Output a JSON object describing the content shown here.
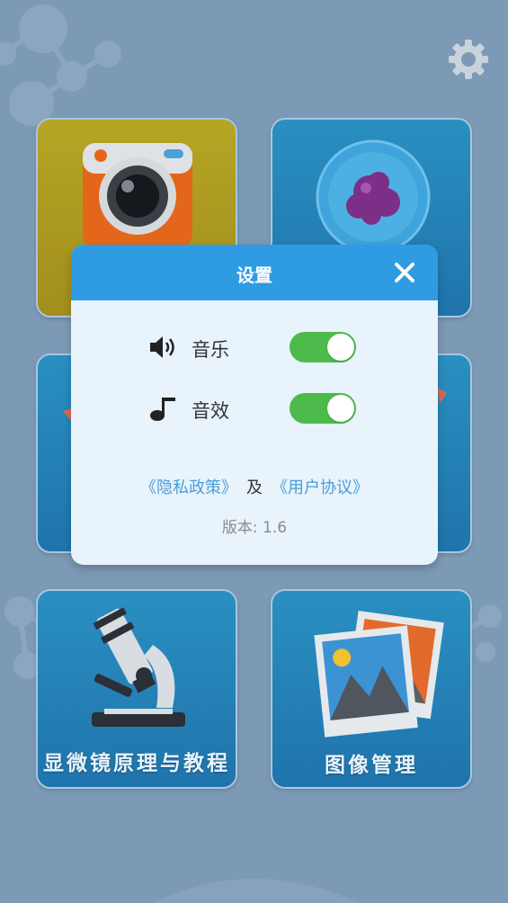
{
  "home": {
    "tiles": [
      {
        "label": ""
      },
      {
        "label": ""
      },
      {
        "label": ""
      },
      {
        "label": ""
      },
      {
        "label": "显微镜原理与教程"
      },
      {
        "label": "图像管理"
      }
    ]
  },
  "settings_dialog": {
    "title": "设置",
    "music_label": "音乐",
    "music_enabled": true,
    "sound_label": "音效",
    "sound_enabled": true,
    "privacy_link": "《隐私政策》",
    "and_text": "及",
    "agreement_link": "《用户协议》",
    "version_text": "版本: 1.6"
  },
  "colors": {
    "background": "#7c99b6",
    "header": "#2f9be2",
    "toggle_on": "#4cbb4c",
    "link": "#4a9fd5"
  },
  "icons": [
    "settings-gear-icon",
    "close-icon",
    "speaker-icon",
    "music-note-icon",
    "camera-icon",
    "cell-icon",
    "microscope-icon",
    "photos-icon"
  ]
}
